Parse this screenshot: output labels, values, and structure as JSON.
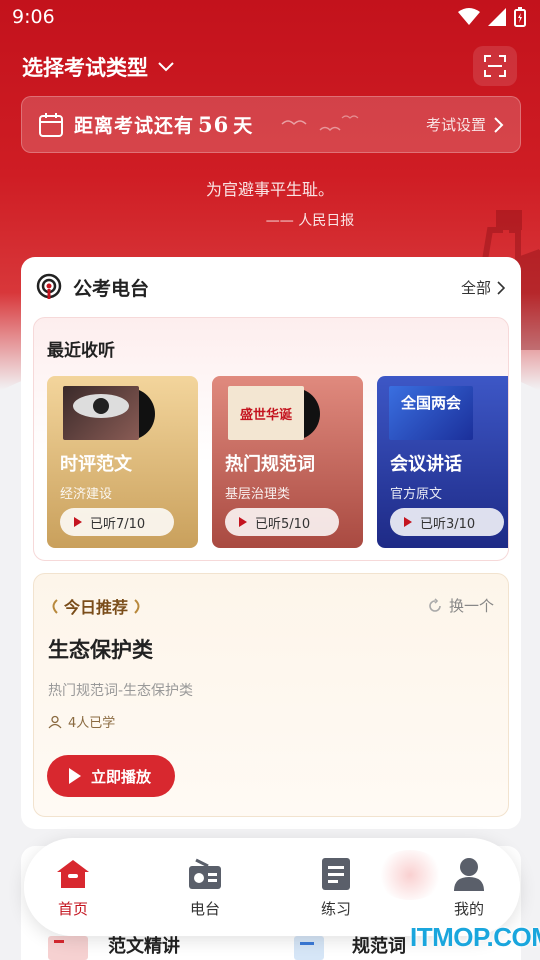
{
  "status_bar": {
    "time": "9:06"
  },
  "header": {
    "exam_type_label": "选择考试类型"
  },
  "countdown": {
    "prefix": "距离考试还有",
    "days": "56",
    "suffix": "天",
    "setting_label": "考试设置"
  },
  "quote": {
    "text": "为官避事平生耻。",
    "source": "—— 人民日报"
  },
  "radio": {
    "title": "公考电台",
    "all_label": "全部",
    "recent": {
      "title": "最近收听",
      "items": [
        {
          "name": "时评范文",
          "category": "经济建设",
          "progress": "已听7/10",
          "color": "#d9b06a"
        },
        {
          "name": "热门规范词",
          "category": "基层治理类",
          "progress": "已听5/10",
          "color": "#bd5a4f",
          "cover_text": "盛世华诞"
        },
        {
          "name": "会议讲话",
          "category": "官方原文",
          "progress": "已听3/10",
          "color": "#2c3a9a",
          "cover_text": "全国两会"
        }
      ]
    },
    "today": {
      "tag": "今日推荐",
      "swap_label": "换一个",
      "topic": "生态保护类",
      "desc": "热门规范词-生态保护类",
      "learned": "4人已学",
      "play_label": "立即播放"
    }
  },
  "lower": {
    "items": [
      {
        "label": "范文精讲"
      },
      {
        "label": "规范词"
      }
    ]
  },
  "tabbar": {
    "tabs": [
      {
        "label": "首页",
        "icon": "home-icon",
        "active": true
      },
      {
        "label": "电台",
        "icon": "radio-icon"
      },
      {
        "label": "练习",
        "icon": "document-icon"
      },
      {
        "label": "我的",
        "icon": "user-icon"
      }
    ]
  },
  "watermark": {
    "text": "ITMOP.COM"
  },
  "colors": {
    "brand_red": "#c4141f",
    "tab_active": "#c4141f",
    "play_button": "#d8282f"
  }
}
